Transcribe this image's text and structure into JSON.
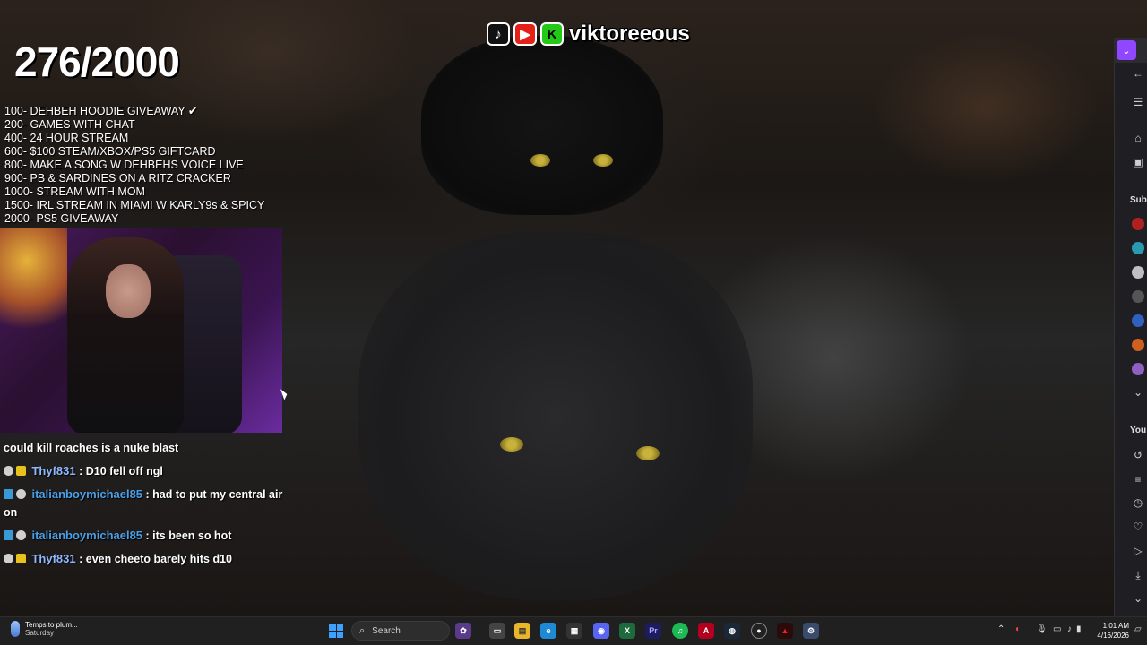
{
  "stream": {
    "counter": "276/2000",
    "brand_name": "viktoreeous",
    "goals": [
      "100- DEHBEH HOODIE GIVEAWAY ✔",
      "200- GAMES WITH CHAT",
      "400- 24 HOUR STREAM",
      "600- $100 STEAM/XBOX/PS5 GIFTCARD",
      "800- MAKE A SONG W DEHBEHS VOICE LIVE",
      "900- PB & SARDINES ON A RITZ CRACKER",
      "1000- STREAM WITH MOM",
      "1500- IRL STREAM IN MIAMI W KARLY9s & SPICY",
      "2000- PS5 GIVEAWAY"
    ]
  },
  "chat": {
    "partial_line": "could kill roaches is a nuke blast",
    "messages": [
      {
        "user": "Thyf831",
        "text": ": D10 fell off ngl"
      },
      {
        "user": "italianboymichael85",
        "text": ": had to put my central air on"
      },
      {
        "user": "italianboymichael85",
        "text": ": its been so hot"
      },
      {
        "user": "Thyf831",
        "text": ": even cheeto barely hits d10"
      }
    ]
  },
  "browser": {
    "section_subscriptions": "Sub",
    "section_you": "You"
  },
  "taskbar": {
    "weather_main": "Temps to plum...",
    "weather_sub": "Saturday",
    "search_placeholder": "Search",
    "time": "1:01 AM",
    "date": "4/16/2026"
  },
  "colors": {
    "taskbar_bg": "#202020",
    "accent_purple": "#9147ff",
    "username_blue": "#8fb8ff",
    "username_cyan": "#4aa0e8"
  }
}
